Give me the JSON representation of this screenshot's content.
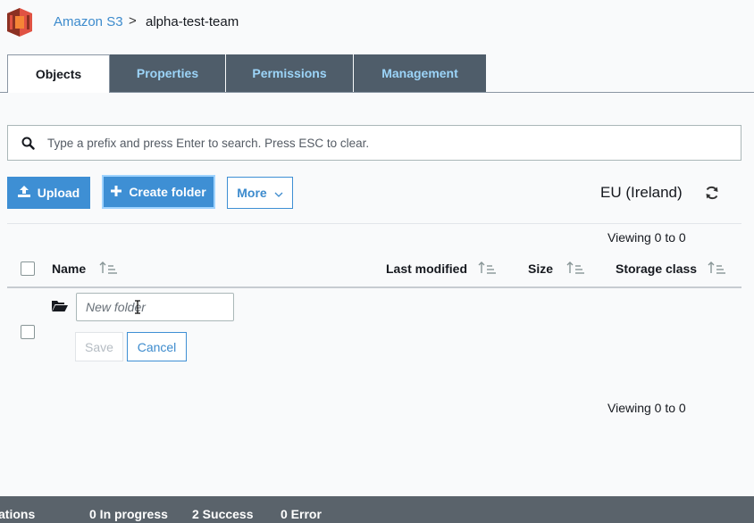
{
  "header": {
    "breadcrumb_root": "Amazon S3",
    "breadcrumb_separator": ">",
    "breadcrumb_current": "alpha-test-team",
    "logo_icon": "aws-s3-bucket-icon"
  },
  "tabs": [
    {
      "label": "Objects",
      "active": true
    },
    {
      "label": "Properties",
      "active": false
    },
    {
      "label": "Permissions",
      "active": false
    },
    {
      "label": "Management",
      "active": false
    }
  ],
  "search": {
    "placeholder": "Type a prefix and press Enter to search. Press ESC to clear.",
    "value": ""
  },
  "toolbar": {
    "upload_label": "Upload",
    "create_folder_label": "Create folder",
    "more_label": "More",
    "region": "EU (Ireland)"
  },
  "table": {
    "viewing_top": "Viewing 0 to 0",
    "viewing_bottom": "Viewing 0 to 0",
    "columns": [
      "Name",
      "Last modified",
      "Size",
      "Storage class"
    ]
  },
  "new_folder": {
    "placeholder": "New folder",
    "value": "",
    "save_label": "Save",
    "cancel_label": "Cancel"
  },
  "status_bar": {
    "operations": "ations",
    "in_progress": "0 In progress",
    "success": "2 Success",
    "error": "0 Error"
  },
  "colors": {
    "accent": "#3e8fd4",
    "tab_inactive_bg": "#4f5d6a",
    "tab_inactive_text": "#9cd4f8",
    "logo_red": "#d9472b",
    "status_bar_bg": "#5a636b"
  }
}
